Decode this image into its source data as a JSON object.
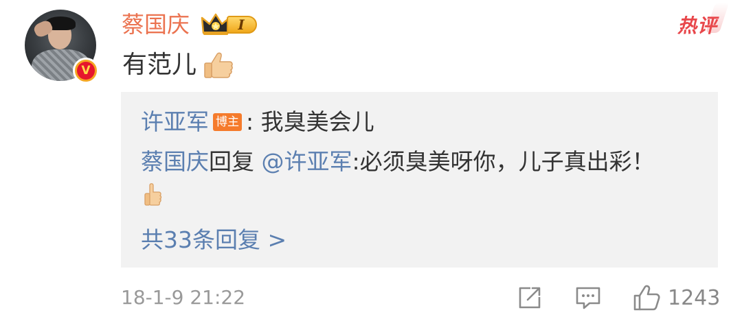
{
  "comment": {
    "username": "蔡国庆",
    "member_level": "I",
    "hot_label": "热评",
    "text": "有范儿",
    "timestamp": "18-1-9 21:22",
    "like_count": "1243"
  },
  "replies": {
    "first": {
      "author": "许亚军",
      "author_tag": "博主",
      "separator": ":",
      "text": "我臭美会儿"
    },
    "second": {
      "author": "蔡国庆",
      "reply_word": "回复",
      "mention": "@许亚军",
      "text": ":必须臭美呀你，儿子真出彩！"
    },
    "more_label": "共33条回复 >"
  },
  "icons": {
    "verified": "verified-v-icon",
    "crown": "crown-icon",
    "thumbs_up_emoji": "thumbs-up-emoji",
    "share": "share-icon",
    "comment": "comment-icon",
    "like": "like-icon"
  },
  "colors": {
    "username": "#eb7350",
    "link": "#5b7fb0",
    "hot": "#e8474b",
    "blogger_tag": "#f57b2c",
    "reply_bg": "#f2f2f2",
    "meta": "#999999"
  }
}
